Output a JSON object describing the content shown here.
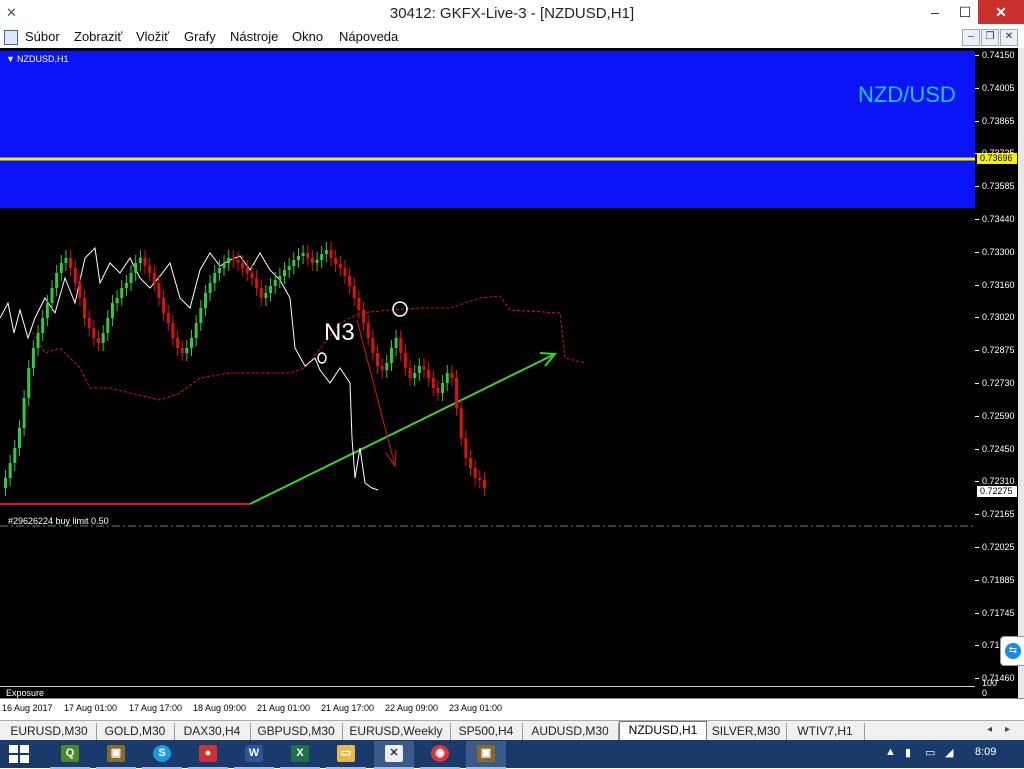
{
  "window": {
    "title": "30412: GKFX-Live-3 - [NZDUSD,H1]",
    "minimize": "–",
    "maximize": "☐",
    "close": "✕"
  },
  "menu": [
    "Súbor",
    "Zobraziť",
    "Vložiť",
    "Grafy",
    "Nástroje",
    "Okno",
    "Nápoveda"
  ],
  "mdi_controls": [
    "–",
    "❐",
    "✕"
  ],
  "chart": {
    "symbol_label": "NZDUSD,H1",
    "banner_text": "NZD/USD",
    "annotation_n3": "N3",
    "order_label": "#29626224 buy limit 0.50",
    "exposure_label": "Exposure",
    "price_labels": [
      "0.74150",
      "0.74005",
      "0.73865",
      "0.73725",
      "0.73585",
      "0.73440",
      "0.73300",
      "0.73160",
      "0.73020",
      "0.72875",
      "0.72730",
      "0.72590",
      "0.72450",
      "0.72310",
      "0.72165",
      "0.72025",
      "0.71885",
      "0.71745",
      "0.71605",
      "0.71460"
    ],
    "current_price_tag": "0.72275",
    "yellow_line_tag": "0.73696",
    "exposure_axis_labels": [
      "100",
      "0"
    ],
    "time_labels": [
      "16 Aug 2017",
      "17 Aug 01:00",
      "17 Aug 17:00",
      "18 Aug 09:00",
      "21 Aug 01:00",
      "21 Aug 17:00",
      "22 Aug 09:00",
      "23 Aug 01:00"
    ],
    "colors": {
      "background": "#000000",
      "banner": "#0a14f5",
      "yellow_line": "#f5f000",
      "bull_candle": "#2ecc40",
      "bear_candle": "#e01010",
      "trend_line": "#3ad12a",
      "support_line": "#e01010",
      "order_line": "#3aa03a",
      "chikou": "#ffffff",
      "kumo": "#e01010",
      "banner_text": "#1ec8f0"
    }
  },
  "tabs": [
    "EURUSD,M30",
    "GOLD,M30",
    "DAX30,H4",
    "GBPUSD,M30",
    "EURUSD,Weekly",
    "SP500,H4",
    "AUDUSD,M30",
    "NZDUSD,H1",
    "SILVER,M30",
    "WTIV7,H1"
  ],
  "active_tab": "NZDUSD,H1",
  "taskbar": {
    "apps": [
      "Ie",
      "Fl",
      "Sk",
      "Ch",
      "W",
      "X",
      "Ex",
      "Mt",
      "Gc",
      "Mt2"
    ],
    "clock": "8:09"
  }
}
